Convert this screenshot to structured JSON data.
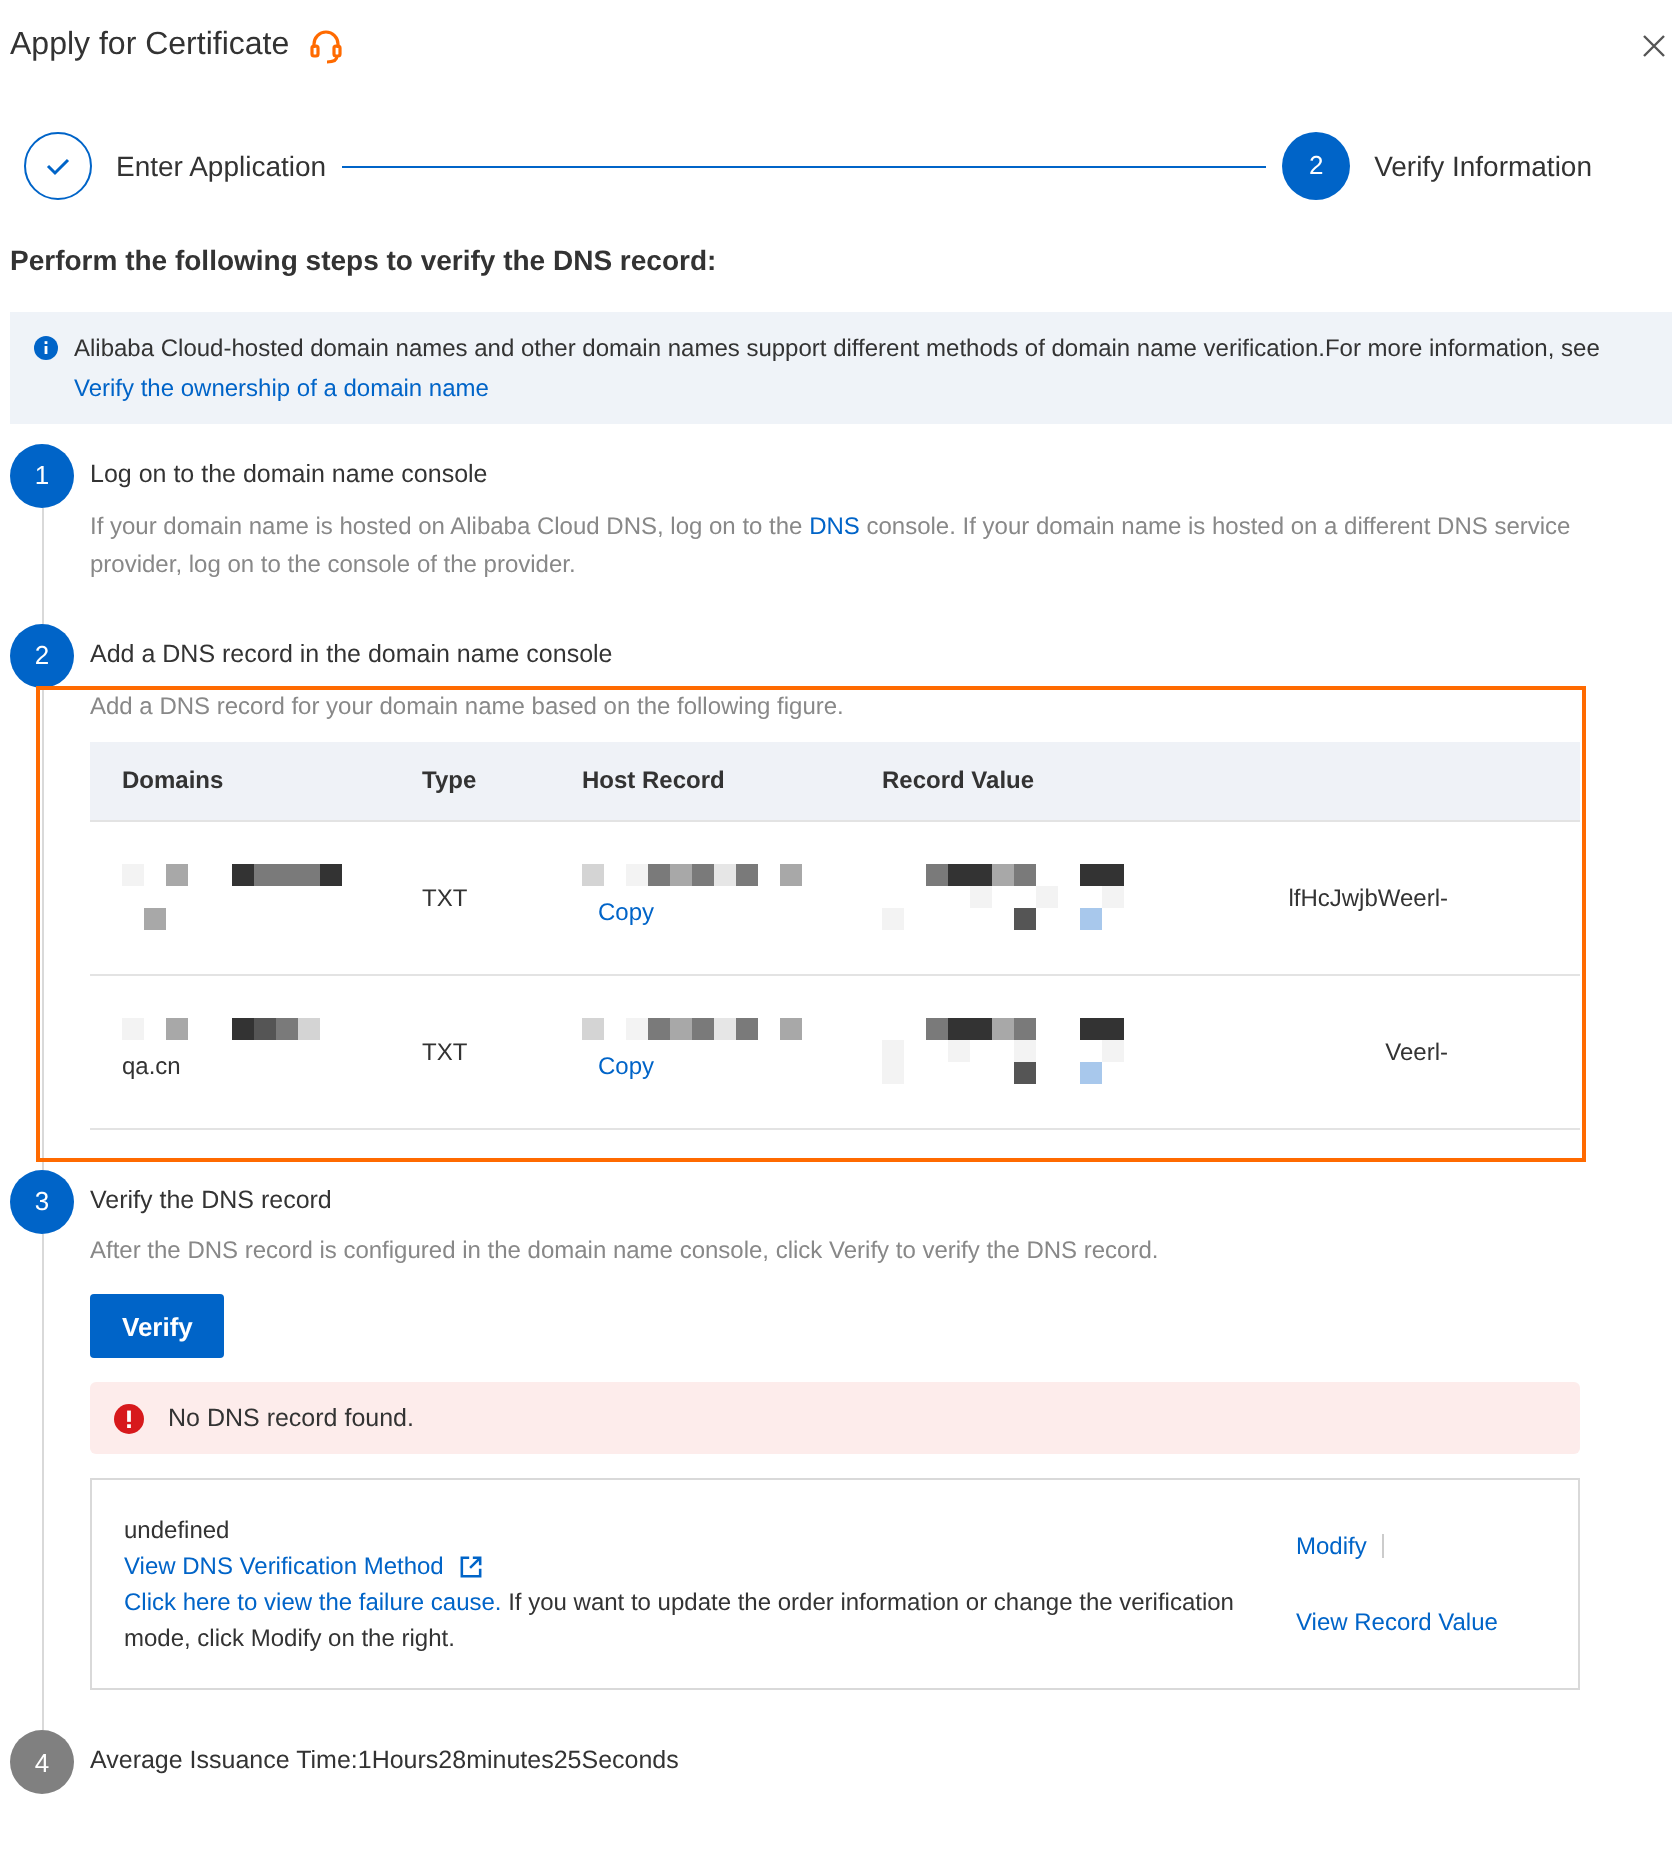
{
  "dialog": {
    "title": "Apply for Certificate"
  },
  "wizard": [
    {
      "kind": "done",
      "label": "Enter Application"
    },
    {
      "kind": "current",
      "number": "2",
      "label": "Verify Information"
    }
  ],
  "heading": "Perform the following steps to verify the DNS record:",
  "notice": {
    "text": "Alibaba Cloud-hosted domain names and other domain names support different methods of domain name verification.For more information, see ",
    "link": "Verify the ownership of a domain name"
  },
  "steps": [
    {
      "kind": "text",
      "number": "1",
      "active": true,
      "title": "Log on to the domain name console",
      "before": "If your domain name is hosted on Alibaba Cloud DNS, log on to the ",
      "link": "DNS",
      "after": " console. If your domain name is hosted on a different DNS service provider, log on to the console of the provider."
    },
    {
      "kind": "table",
      "number": "2",
      "active": true,
      "title": "Add a DNS record in the domain name console",
      "description": "Add a DNS record for your domain name based on the following figure.",
      "columns": [
        "Domains",
        "Type",
        "Host Record",
        "Record Value"
      ],
      "rows": [
        {
          "domain": "",
          "type": "TXT",
          "copy": "Copy",
          "value": "lfHcJwjbWeerl-"
        },
        {
          "domain": "qa.cn",
          "type": "TXT",
          "copy": "Copy",
          "value": "Veerl-"
        }
      ]
    },
    {
      "kind": "verify",
      "number": "3",
      "active": true,
      "title": "Verify the DNS record",
      "description": "After the DNS record is configured in the domain name console, click Verify to verify the DNS record.",
      "button": "Verify",
      "alert": "No DNS record found.",
      "result": {
        "status": "undefined",
        "method_link": "View DNS Verification Method",
        "cause_link": "Click here to view the failure cause.",
        "cause_text": " If you want to update the order information or change the verification mode, click Modify on the right.",
        "actions": [
          "Modify",
          "View Record Value"
        ]
      }
    },
    {
      "kind": "plain",
      "number": "4",
      "active": false,
      "title": "Average Issuance Time:1Hours28minutes25Seconds"
    }
  ]
}
